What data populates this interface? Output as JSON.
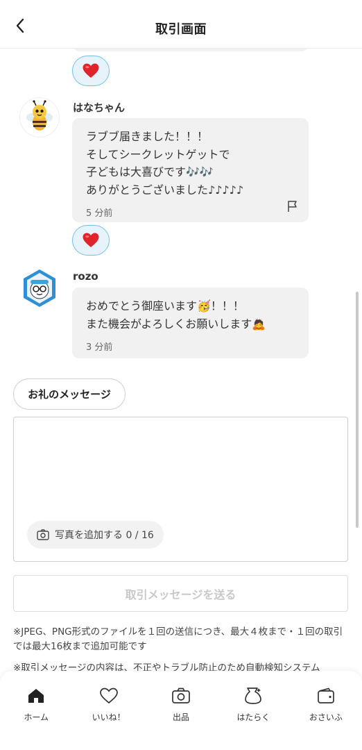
{
  "header": {
    "title": "取引画面"
  },
  "messages": [
    {
      "username": "はなちゃん",
      "text": "ラブブ届きました！！！\nそしてシークレットゲットで\n子どもは大喜びです🎶🎶\nありがとうございました♪♪♪♪♪",
      "time": "5 分前"
    },
    {
      "username": "rozo",
      "text": "おめでとう御座います🥳！！！\nまた機会がよろしくお願いします🙇",
      "time": "3 分前"
    }
  ],
  "compose": {
    "thanks_label": "お礼のメッセージ",
    "add_photo_label": "写真を追加する 0 / 16",
    "send_label": "取引メッセージを送る"
  },
  "notes": {
    "line1": "※JPEG、PNG形式のファイルを１回の送信につき、最大４枚まで・１回の取引では最大16枚まで追加可能です",
    "line2": "※取引メッセージの内容は、不正やトラブル防止のため自動検知システム"
  },
  "nav": {
    "items": [
      {
        "label": "ホーム",
        "icon": "home-icon"
      },
      {
        "label": "いいね！",
        "icon": "heart-icon"
      },
      {
        "label": "出品",
        "icon": "camera-icon"
      },
      {
        "label": "はたらく",
        "icon": "money-bag-icon"
      },
      {
        "label": "おさいふ",
        "icon": "wallet-icon"
      }
    ]
  },
  "colors": {
    "reaction_border": "#6fc0ec",
    "reaction_bg": "#e6f3fb",
    "heart": "#e0242b",
    "bubble_bg": "#f1f1f1",
    "send_disabled_text": "#c8c8c8"
  }
}
